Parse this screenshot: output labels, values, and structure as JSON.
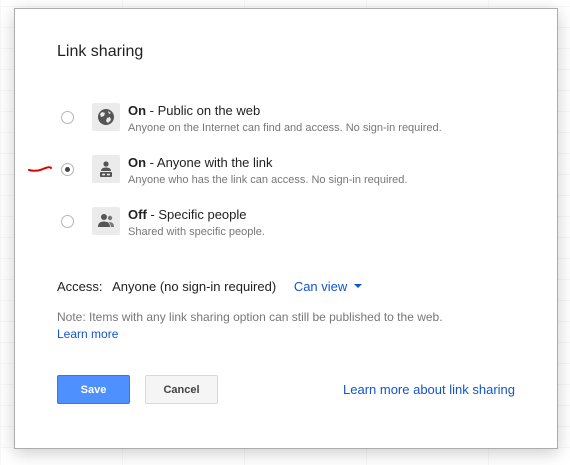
{
  "dialog": {
    "title": "Link sharing"
  },
  "options": [
    {
      "state": "On",
      "label": " - Public on the web",
      "description": "Anyone on the Internet can find and access. No sign-in required.",
      "icon": "globe-icon",
      "selected": false
    },
    {
      "state": "On",
      "label": " - Anyone with the link",
      "description": "Anyone who has the link can access. No sign-in required.",
      "icon": "person-link-icon",
      "selected": true
    },
    {
      "state": "Off",
      "label": " - Specific people",
      "description": "Shared with specific people.",
      "icon": "people-icon",
      "selected": false
    }
  ],
  "access": {
    "label": "Access:",
    "value": "Anyone (no sign-in required)",
    "permission": "Can view"
  },
  "note": {
    "text": "Note: Items with any link sharing option can still be published to the web.",
    "link": "Learn more"
  },
  "buttons": {
    "save": "Save",
    "cancel": "Cancel"
  },
  "footer_link": "Learn more about link sharing",
  "colors": {
    "link": "#1155cc",
    "primary_button": "#4d90fe",
    "annotation": "#e00000"
  }
}
